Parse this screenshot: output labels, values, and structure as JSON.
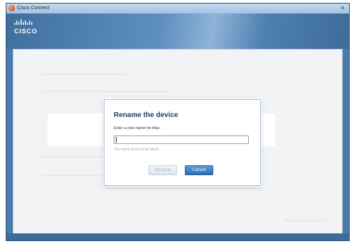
{
  "window": {
    "title": "Cisco Connect",
    "close_glyph": "✕"
  },
  "header": {
    "logo_text": "CISCO"
  },
  "dialog": {
    "title": "Rename the device",
    "prompt": "Enter a new name for Mac:",
    "input_value": "",
    "hint": "The name must not be blank.",
    "rename_label": "Rename",
    "cancel_label": "Cancel"
  },
  "colors": {
    "window_blue": "#4a7cab",
    "dialog_title": "#1f3f6e",
    "primary_button": "#2f6fb1"
  },
  "icons": {
    "app": "cisco-app-icon",
    "close": "close-icon",
    "logo": "cisco-logo-bars"
  }
}
